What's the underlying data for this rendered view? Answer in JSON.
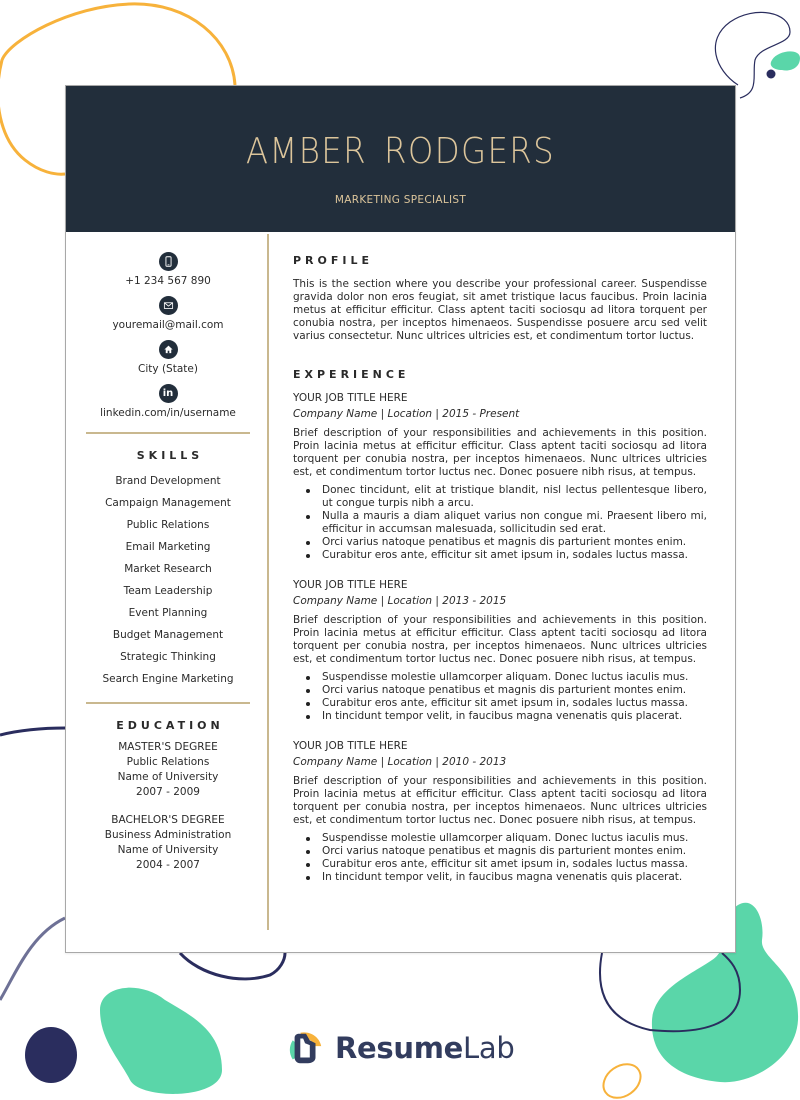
{
  "header": {
    "name": "AMBER  RODGERS",
    "job_title": "MARKETING SPECIALIST"
  },
  "contact": {
    "items": [
      {
        "icon": "phone-icon",
        "text": "+1 234 567 890"
      },
      {
        "icon": "mail-icon",
        "text": "youremail@mail.com"
      },
      {
        "icon": "home-icon",
        "text": "City (State)"
      },
      {
        "icon": "linkedin-icon",
        "text": "linkedin.com/in/username",
        "glyph": "in"
      }
    ]
  },
  "skills": {
    "heading": "SKILLS",
    "items": [
      "Brand Development",
      "Campaign Management",
      "Public Relations",
      "Email Marketing",
      "Market Research",
      "Team Leadership",
      "Event Planning",
      "Budget Management",
      "Strategic Thinking",
      "Search Engine Marketing"
    ]
  },
  "education": {
    "heading": "EDUCATION",
    "entries": [
      {
        "degree": "MASTER'S DEGREE",
        "field": "Public Relations",
        "school": "Name of University",
        "years": "2007 - 2009"
      },
      {
        "degree": "BACHELOR'S DEGREE",
        "field": "Business Administration",
        "school": "Name of University",
        "years": "2004 - 2007"
      }
    ]
  },
  "profile": {
    "heading": "PROFILE",
    "text": "This is the section where you describe your professional career. Suspendisse gravida dolor non eros feugiat, sit amet tristique lacus faucibus. Proin lacinia metus at efficitur efficitur. Class aptent taciti sociosqu ad litora torquent per conubia nostra, per inceptos himenaeos. Suspendisse posuere arcu sed velit varius consectetur. Nunc ultrices ultricies est, et condimentum tortor luctus."
  },
  "experience": {
    "heading": "EXPERIENCE",
    "jobs": [
      {
        "title": "YOUR JOB TITLE HERE",
        "meta": "Company Name | Location | 2015 - Present",
        "description": "Brief description of your responsibilities and achievements in this position. Proin lacinia metus at efficitur efficitur. Class aptent taciti sociosqu ad litora torquent per conubia nostra, per inceptos himenaeos. Nunc ultrices ultricies est, et condimentum tortor luctus nec. Donec posuere nibh risus, at tempus.",
        "bullets": [
          "Donec tincidunt, elit at tristique blandit, nisl lectus pellentesque libero, ut congue turpis nibh a arcu.",
          "Nulla a mauris a diam aliquet varius non congue mi. Praesent libero mi, efficitur in accumsan malesuada, sollicitudin sed erat.",
          "Orci varius natoque penatibus et magnis dis parturient montes enim.",
          "Curabitur eros ante, efficitur sit amet ipsum in, sodales luctus massa."
        ]
      },
      {
        "title": "YOUR JOB TITLE HERE",
        "meta": "Company Name | Location | 2013 - 2015",
        "description": "Brief description of your responsibilities and achievements in this position. Proin lacinia metus at efficitur efficitur. Class aptent taciti sociosqu ad litora torquent per conubia nostra, per inceptos himenaeos. Nunc ultrices ultricies est, et condimentum tortor luctus nec. Donec posuere nibh risus, at tempus.",
        "bullets": [
          "Suspendisse molestie ullamcorper aliquam. Donec luctus iaculis mus.",
          "Orci varius natoque penatibus et magnis dis parturient montes enim.",
          "Curabitur eros ante, efficitur sit amet ipsum in, sodales luctus massa.",
          "In tincidunt tempor velit, in faucibus magna venenatis quis placerat."
        ]
      },
      {
        "title": "YOUR JOB TITLE HERE",
        "meta": "Company Name | Location | 2010 - 2013",
        "description": "Brief description of your responsibilities and achievements in this position. Proin lacinia metus at efficitur efficitur. Class aptent taciti sociosqu ad litora torquent per conubia nostra, per inceptos himenaeos. Nunc ultrices ultricies est, et condimentum tortor luctus nec. Donec posuere nibh risus, at tempus.",
        "bullets": [
          "Suspendisse molestie ullamcorper aliquam. Donec luctus iaculis mus.",
          "Orci varius natoque penatibus et magnis dis parturient montes enim.",
          "Curabitur eros ante, efficitur sit amet ipsum in, sodales luctus massa.",
          "In tincidunt tempor velit, in faucibus magna venenatis quis placerat."
        ]
      }
    ]
  },
  "brand": {
    "name_bold": "Resume",
    "name_light": "Lab"
  },
  "colors": {
    "header_bg": "#222e3b",
    "accent_gold": "#dcc59b",
    "divider": "#c9b88f",
    "deco_orange": "#f7b23b",
    "deco_teal": "#5ad6a9",
    "deco_navy": "#2a2d5e"
  }
}
